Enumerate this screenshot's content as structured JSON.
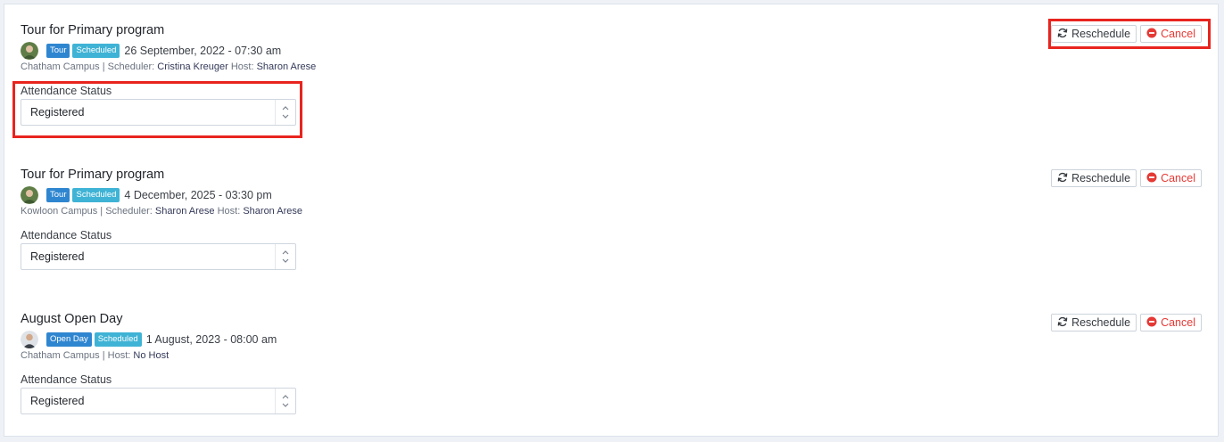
{
  "ui": {
    "attendance_label": "Attendance Status",
    "reschedule_label": "Reschedule",
    "cancel_label": "Cancel",
    "colors": {
      "type_badge": "#2f86d0",
      "status_badge": "#3fb3d5",
      "cancel": "#e53935",
      "highlight": "#e8241f"
    }
  },
  "events": [
    {
      "title": "Tour for Primary program",
      "type_badge": "Tour",
      "status_badge": "Scheduled",
      "datetime": "26 September, 2022 - 07:30 am",
      "campus": "Chatham Campus",
      "scheduler_label": "Scheduler:",
      "scheduler": "Cristina Kreuger",
      "host_label": "Host:",
      "host": "Sharon Arese",
      "attendance": "Registered",
      "avatar_icon": "host-avatar"
    },
    {
      "title": "Tour for Primary program",
      "type_badge": "Tour",
      "status_badge": "Scheduled",
      "datetime": "4 December, 2025 - 03:30 pm",
      "campus": "Kowloon Campus",
      "scheduler_label": "Scheduler:",
      "scheduler": "Sharon Arese",
      "host_label": "Host:",
      "host": "Sharon Arese",
      "attendance": "Registered",
      "avatar_icon": "host-avatar"
    },
    {
      "title": "August Open Day",
      "type_badge": "Open Day",
      "status_badge": "Scheduled",
      "datetime": "1 August, 2023 - 08:00 am",
      "campus": "Chatham Campus",
      "host_label": "Host:",
      "host": "No Host",
      "attendance": "Registered",
      "avatar_icon": "host-avatar"
    }
  ]
}
